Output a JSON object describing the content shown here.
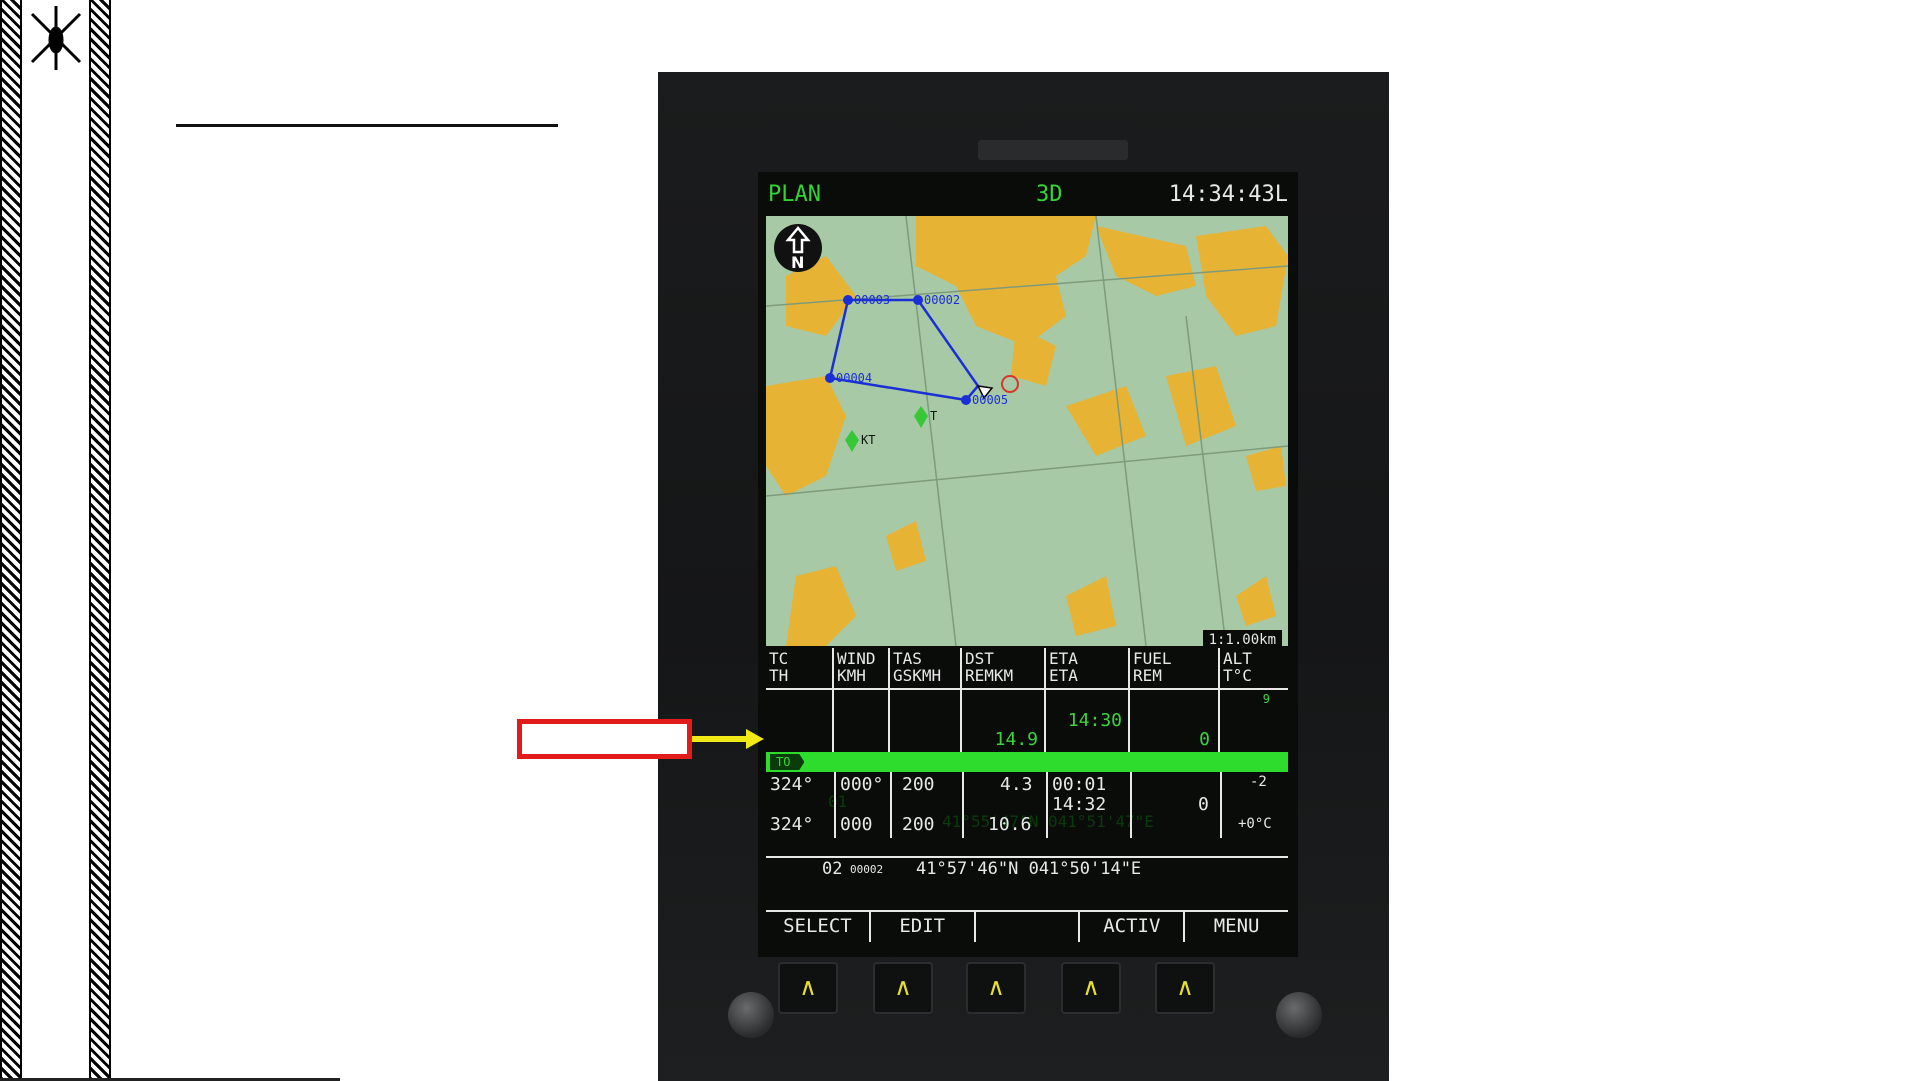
{
  "screen": {
    "header": {
      "page": "PLAN",
      "mode": "3D",
      "clock": "14:34:43L"
    },
    "map": {
      "north_label": "N",
      "scale": "1:1.00km",
      "waypoints": [
        {
          "label": "00003"
        },
        {
          "label": "00002"
        },
        {
          "label": "00004"
        },
        {
          "label": "00005"
        }
      ],
      "markers": [
        {
          "label": "T"
        },
        {
          "label": "KT"
        }
      ]
    },
    "table": {
      "headers": [
        {
          "l1": "TC",
          "l2": "TH"
        },
        {
          "l1": "WIND",
          "l2": "KMH"
        },
        {
          "l1": "TAS",
          "l2": "GSKMH"
        },
        {
          "l1": "DST",
          "l2": "REMKM"
        },
        {
          "l1": "ETA",
          "l2": "ETA"
        },
        {
          "l1": "FUEL",
          "l2": "REM"
        },
        {
          "l1": "ALT",
          "l2": "T°C"
        }
      ],
      "green_values": {
        "dst": "14.9",
        "eta": "14:30",
        "fuel": "0",
        "alt": "9"
      },
      "to_row": {
        "tag": "TO",
        "waypoint": "01",
        "coords": "41°55'47\"N 041°51'47\"E"
      },
      "row1": {
        "tc": "324°",
        "wind": "000°",
        "tas": "200",
        "dst": "4.3",
        "eta": "00:01",
        "alt": "-2"
      },
      "row2": {
        "th": "324°",
        "wind": "000",
        "gs": "200",
        "rem": "10.6",
        "eta": "14:32",
        "fuel": "0",
        "temp": "+0°C"
      },
      "next": {
        "num": "02",
        "name": "00002",
        "coords": "41°57'46\"N 041°50'14\"E"
      }
    },
    "softkeys": [
      "SELECT",
      "EDIT",
      "",
      "ACTIV",
      "MENU"
    ]
  },
  "buttons": [
    "∧",
    "∧",
    "∧",
    "∧",
    "∧"
  ],
  "colors": {
    "map_land": "#a8c9a5",
    "map_forest": "#e6b335",
    "route": "#1a2fd6",
    "green": "#2edc2e",
    "annotation": "#e21b1b",
    "arrow": "#f2ea17"
  }
}
